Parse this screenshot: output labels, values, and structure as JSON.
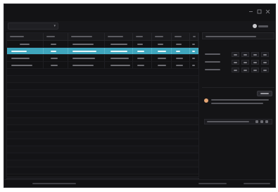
{
  "window": {
    "title": ""
  },
  "toolbar": {
    "view_select_value": "",
    "top_right_action_label": ""
  },
  "table": {
    "columns": [
      "",
      "",
      "",
      "",
      "",
      "",
      "",
      ""
    ],
    "rows": [
      {
        "cells": [
          "",
          "",
          "",
          "",
          "",
          "",
          "",
          ""
        ],
        "selected": false
      },
      {
        "cells": [
          "",
          "",
          "",
          "",
          "",
          "",
          "",
          ""
        ],
        "selected": true
      },
      {
        "cells": [
          "",
          "",
          "",
          "",
          "",
          "",
          "",
          ""
        ],
        "selected": false
      },
      {
        "cells": [
          "",
          "",
          "",
          "",
          "",
          "",
          "",
          ""
        ],
        "selected": false
      }
    ],
    "empty_rows": 15
  },
  "panel": {
    "header": "",
    "properties": [
      {
        "label": "",
        "values": [
          "",
          "",
          "",
          ""
        ]
      },
      {
        "label": "",
        "values": [
          "",
          "",
          "",
          ""
        ]
      },
      {
        "label": "",
        "values": [
          "",
          "",
          "",
          ""
        ]
      }
    ],
    "button_label": "",
    "notice_lines": [
      "",
      ""
    ],
    "mini_toolbar_label": ""
  },
  "statusbar": {
    "left": "",
    "middle": "",
    "right": ""
  },
  "colors": {
    "selection": "#3fa6bd",
    "window_bg": "#141416",
    "notice_icon": "#e4a574"
  }
}
